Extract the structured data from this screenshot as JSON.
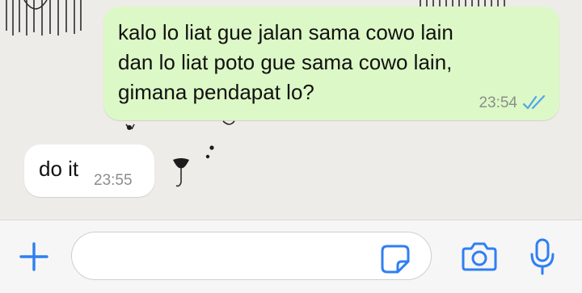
{
  "messages": [
    {
      "direction": "outgoing",
      "text": "kalo lo liat gue jalan sama cowo lain\ndan lo liat poto gue sama cowo lain,\ngimana pendapat lo?",
      "time": "23:54",
      "status": "read"
    },
    {
      "direction": "incoming",
      "text": "do it",
      "time": "23:55"
    }
  ],
  "input_bar": {
    "placeholder": "",
    "icons": [
      "plus-icon",
      "sticker-icon",
      "camera-icon",
      "microphone-icon"
    ]
  },
  "colors": {
    "accent": "#2f7ff2",
    "outgoing_bubble": "#dcf8c6",
    "incoming_bubble": "#ffffff",
    "read_ticks": "#4fa6e8",
    "timestamp": "#8a8f8a"
  }
}
